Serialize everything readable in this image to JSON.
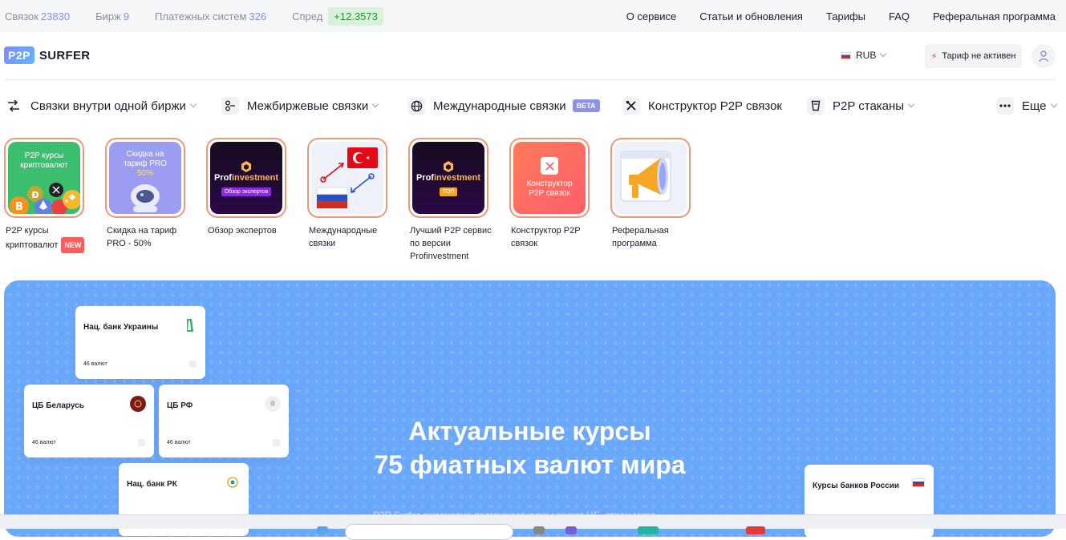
{
  "topbar": {
    "stats": [
      {
        "label": "Связок",
        "value": "23830"
      },
      {
        "label": "Бирж",
        "value": "9"
      },
      {
        "label": "Платежных систем",
        "value": "326"
      }
    ],
    "spread_label": "Спред",
    "spread_value": "+12.3573",
    "nav": [
      "О сервисе",
      "Статьи и обновления",
      "Тарифы",
      "FAQ",
      "Реферальная программа"
    ]
  },
  "header": {
    "logo_badge": "P2P",
    "logo_text": "SURFER",
    "currency": "RUB",
    "tariff": "Тариф не активен"
  },
  "nav": {
    "items": [
      {
        "label": "Связки внутри одной биржи",
        "icon": "arbitrage-icon",
        "has_dropdown": true
      },
      {
        "label": "Межбиржевые связки",
        "icon": "exchange-icon",
        "has_dropdown": true
      },
      {
        "label": "Международные связки",
        "icon": "globe-icon",
        "badge": "BETA"
      },
      {
        "label": "Конструктор P2P связок",
        "icon": "tools-icon"
      },
      {
        "label": "P2P стаканы",
        "icon": "glass-icon",
        "has_dropdown": true
      },
      {
        "label": "Еще",
        "icon": "more-icon",
        "has_dropdown": true
      }
    ]
  },
  "stories": [
    {
      "caption": "P2P курсы криптовалют",
      "badge": "NEW",
      "image_text": "P2P курсы криптовалют"
    },
    {
      "caption": "Скидка на тариф PRO - 50%",
      "image_text": "Скидка на тариф PRO",
      "image_sub": "50%"
    },
    {
      "caption": "Обзор экспертов",
      "image_logo_a": "Prof",
      "image_logo_b": "investment",
      "image_sub": "Обзор экспертов"
    },
    {
      "caption": "Международные связки"
    },
    {
      "caption": "Лучший P2P сервис по версии Profinvestment",
      "image_logo_a": "Prof",
      "image_logo_b": "investment",
      "image_sub": "ТОП"
    },
    {
      "caption": "Конструктор P2P связок",
      "image_text": "Конструктор P2P связок"
    },
    {
      "caption": "Реферальная программа"
    }
  ],
  "hero": {
    "title_line1": "Актуальные курсы",
    "title_line2": "75 фиатных валют мира",
    "subtitle": "P2P Surfer ежедневно подгружает курсы валют ЦБ, стран мира",
    "cards": [
      {
        "name": "Нац. банк Украины",
        "count": "46 валют"
      },
      {
        "name": "ЦБ Беларусь",
        "count": "46 валют"
      },
      {
        "name": "ЦБ РФ",
        "count": "46 валют"
      },
      {
        "name": "Нац. банк РК",
        "count": ""
      },
      {
        "name": "Курсы банков России",
        "count": ""
      }
    ]
  },
  "colors": {
    "accent": "#8b8fd6",
    "spread_bg": "#d7f1da",
    "spread_text": "#2c8f3d",
    "story_ring": "#f19777",
    "hero_bg": "#6aa8fb",
    "beta": "#8c92e6",
    "new_badge": "#ff5b5b"
  }
}
